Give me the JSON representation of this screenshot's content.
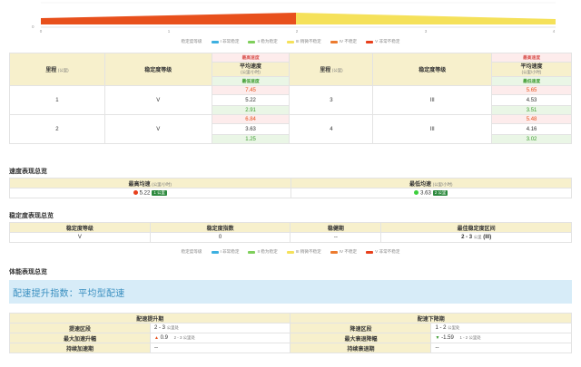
{
  "top_chart": {
    "x_ticks": [
      "0",
      "1",
      "2",
      "3",
      "4"
    ],
    "y_tick": "0",
    "band_colors": {
      "left": "#e8501c",
      "right": "#f5e15a"
    }
  },
  "legend": {
    "label": "稳定度等级",
    "items": [
      {
        "text": "I 非常稳定",
        "color": "#3db0e0"
      },
      {
        "text": "II 稳为稳定",
        "color": "#7fcf5b"
      },
      {
        "text": "III 稍微不稳定",
        "color": "#f5e15a"
      },
      {
        "text": "IV 不稳定",
        "color": "#ec7b2f"
      },
      {
        "text": "V 非常不稳定",
        "color": "#e8401c"
      }
    ]
  },
  "main_table": {
    "headers": {
      "mileage": "里程",
      "mileage_unit": "(公里)",
      "stability": "稳定度等级",
      "max_speed": "最高速度",
      "avg_speed": "平均速度",
      "avg_unit": "(公里/小时)",
      "min_speed": "最低速度"
    },
    "rows": [
      {
        "km": "1",
        "level": "V",
        "max": "7.45",
        "avg": "5.22",
        "min": "2.91"
      },
      {
        "km": "2",
        "level": "V",
        "max": "6.84",
        "avg": "3.63",
        "min": "1.25"
      },
      {
        "km": "3",
        "level": "III",
        "max": "5.65",
        "avg": "4.53",
        "min": "3.51"
      },
      {
        "km": "4",
        "level": "III",
        "max": "5.48",
        "avg": "4.16",
        "min": "3.02"
      }
    ]
  },
  "speed_overview": {
    "title": "速度表现总览",
    "max_header": "最高均速",
    "min_header": "最低均速",
    "unit": "(公里/小时)",
    "max_value": "5.22",
    "max_tag": "1 公里",
    "min_value": "3.63",
    "min_tag": "2 公里"
  },
  "stability_overview": {
    "title": "稳定度表现总览",
    "headers": [
      "稳定度等级",
      "稳定度指数",
      "稳健期",
      "最佳稳定度区间"
    ],
    "level": "V",
    "index": "0",
    "robust": "--",
    "best_range": "2 - 3",
    "best_unit": "公里",
    "best_level": "(III)"
  },
  "performance": {
    "title": "体能表现总览",
    "banner": "配速提升指数：平均型配速",
    "up_header": "配速提升期",
    "down_header": "配速下降期",
    "up_rows": [
      {
        "label": "提速区段",
        "value": "2 - 3",
        "unit": "公里处"
      },
      {
        "label": "最大加速升幅",
        "value": "0.9",
        "unit": "2 - 3 公里处"
      },
      {
        "label": "持续加速期",
        "value": "--",
        "unit": ""
      }
    ],
    "down_rows": [
      {
        "label": "降速区段",
        "value": "1 - 2",
        "unit": "公里处"
      },
      {
        "label": "最大衰退降幅",
        "value": "-1.59",
        "unit": "1 - 2 公里处"
      },
      {
        "label": "持续衰退期",
        "value": "--",
        "unit": ""
      }
    ]
  }
}
